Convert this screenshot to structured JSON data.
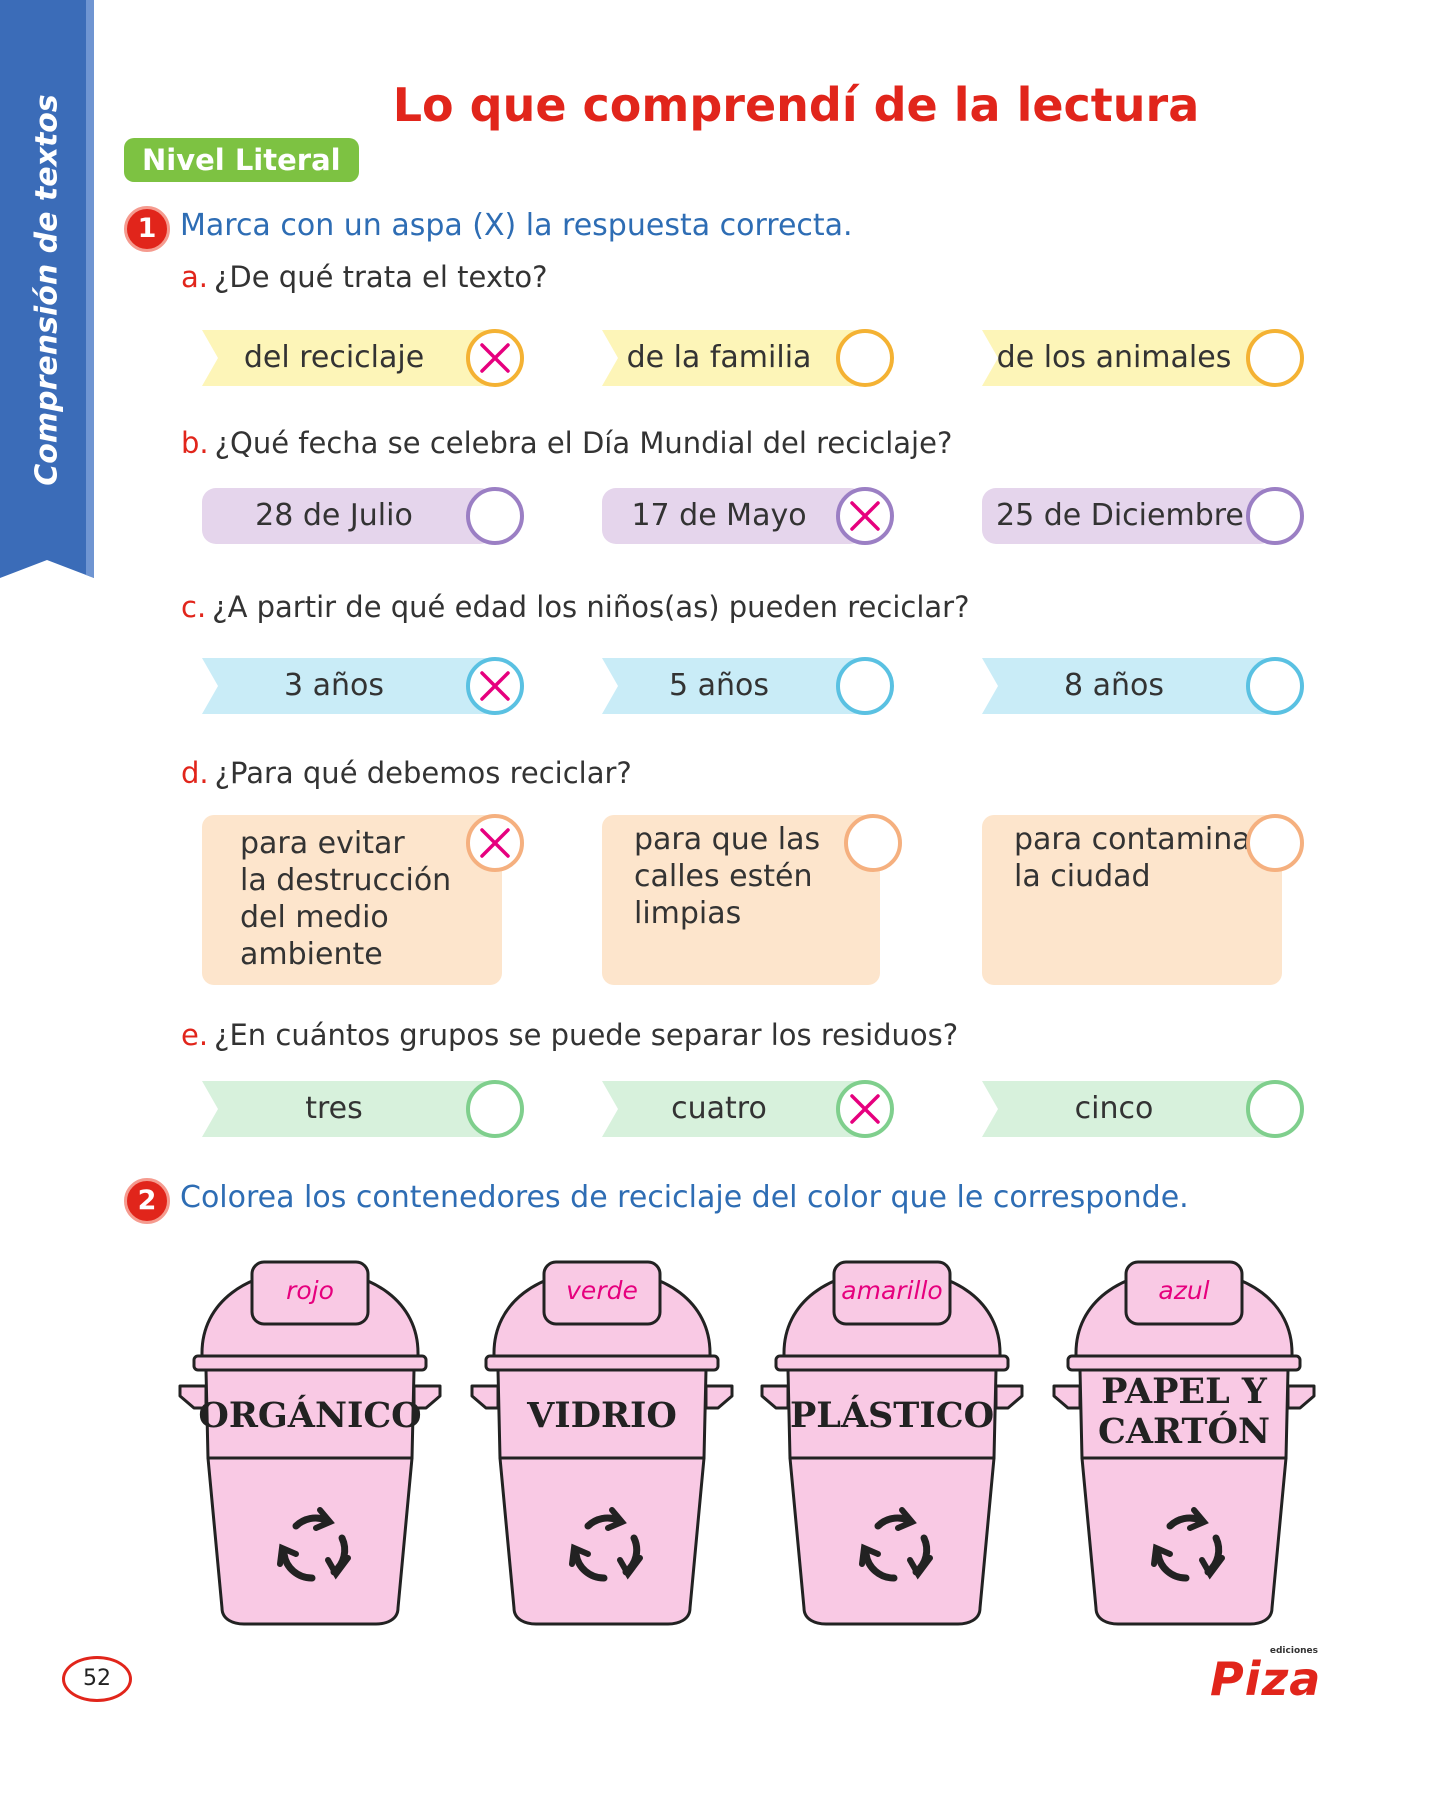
{
  "side_label": "Comprensión de textos",
  "title": "Lo que comprendí de la lectura",
  "level_badge": "Nivel Literal",
  "q1": {
    "number": "1",
    "instruction": "Marca con un aspa (X) la respuesta correcta.",
    "items": [
      {
        "letter": "a.",
        "question": "¿De qué trata el texto?",
        "fill": "#fdf5b8",
        "ring": "#f4b233",
        "options": [
          {
            "label": "del reciclaje",
            "marked": true
          },
          {
            "label": "de la familia",
            "marked": false
          },
          {
            "label": "de los animales",
            "marked": false
          }
        ]
      },
      {
        "letter": "b.",
        "question": "¿Qué fecha se celebra el Día Mundial del reciclaje?",
        "fill": "#e5d5ec",
        "ring": "#9b7fc4",
        "options": [
          {
            "label": "28 de Julio",
            "marked": false
          },
          {
            "label": "17 de Mayo",
            "marked": true
          },
          {
            "label": "25 de Diciembre",
            "marked": false
          }
        ]
      },
      {
        "letter": "c.",
        "question": "¿A partir de qué edad los niños(as) pueden reciclar?",
        "fill": "#c9ecf7",
        "ring": "#5ac1e2",
        "options": [
          {
            "label": "3 años",
            "marked": true
          },
          {
            "label": "5 años",
            "marked": false
          },
          {
            "label": "8 años",
            "marked": false
          }
        ]
      },
      {
        "letter": "d.",
        "question": "¿Para qué debemos reciclar?",
        "fill": "#fde5cc",
        "ring": "#f5b07f",
        "options": [
          {
            "label": "para evitar la destrucción del medio ambiente",
            "lines": [
              "para evitar",
              "la destrucción",
              "del medio",
              "ambiente"
            ],
            "marked": true
          },
          {
            "label": "para que las calles estén limpias",
            "lines": [
              "para que las",
              "calles estén",
              "limpias"
            ],
            "marked": false
          },
          {
            "label": "para contaminar la ciudad",
            "lines": [
              "para contaminar",
              "la ciudad"
            ],
            "marked": false
          }
        ]
      },
      {
        "letter": "e.",
        "question": "¿En cuántos grupos se puede separar los residuos?",
        "fill": "#d7f1dc",
        "ring": "#7fcf8d",
        "options": [
          {
            "label": "tres",
            "marked": false
          },
          {
            "label": "cuatro",
            "marked": true
          },
          {
            "label": "cinco",
            "marked": false
          }
        ]
      }
    ]
  },
  "q2": {
    "number": "2",
    "instruction": "Colorea los contenedores de reciclaje del color que le corresponde.",
    "bins": [
      {
        "color_label": "rojo",
        "name_lines": [
          "ORGÁNICO"
        ]
      },
      {
        "color_label": "verde",
        "name_lines": [
          "VIDRIO"
        ]
      },
      {
        "color_label": "amarillo",
        "name_lines": [
          "PLÁSTICO"
        ]
      },
      {
        "color_label": "azul",
        "name_lines": [
          "PAPEL Y",
          "CARTÓN"
        ]
      }
    ],
    "bin_fill": "#f9c9e4",
    "recycle_icon": "recycle-arrows-icon"
  },
  "cross_color": "#e6007e",
  "page_number": "52",
  "brand": {
    "small": "ediciones",
    "name": "Piza"
  }
}
